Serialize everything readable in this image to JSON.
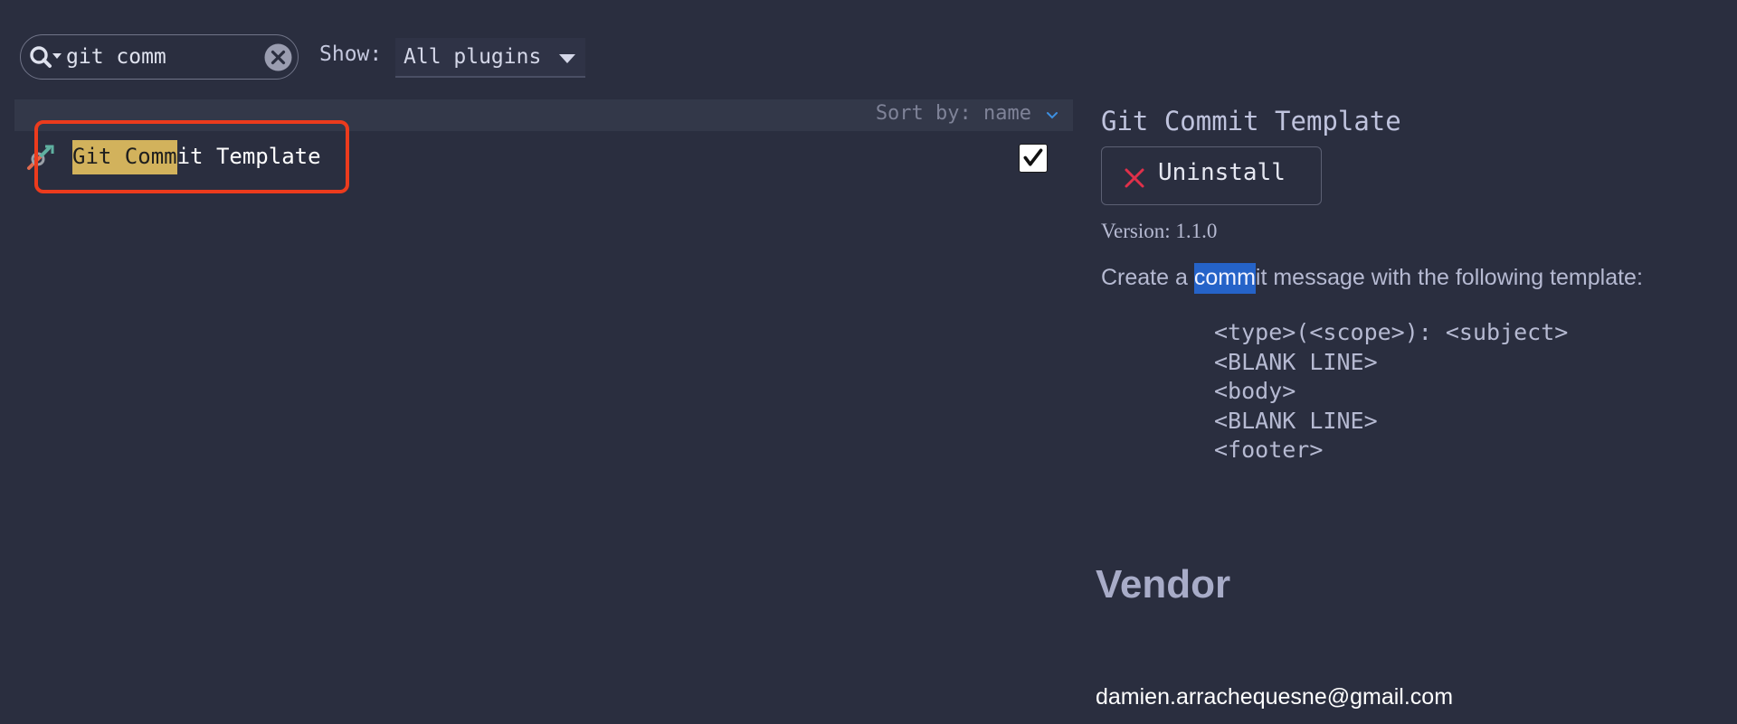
{
  "toolbar": {
    "search": {
      "value": "git comm",
      "icon": "search-icon",
      "clear_icon": "clear-icon"
    },
    "show_label": "Show:",
    "show_value": "All plugins",
    "show_icon": "chevron-down-icon"
  },
  "list": {
    "sort_label": "Sort by: name",
    "sort_icon": "chevron-down-icon",
    "items": [
      {
        "icon": "plugin-icon",
        "name_match": "Git Comm",
        "name_rest": "it Template",
        "enabled": true,
        "check_mark": "✓"
      }
    ]
  },
  "details": {
    "title": "Git Commit Template",
    "uninstall": {
      "icon": "close-icon",
      "label": "Uninstall"
    },
    "version": "Version: 1.1.0",
    "description": {
      "before": "Create a ",
      "match": "comm",
      "after": "it message with the following template:"
    },
    "template_lines": [
      "<type>(<scope>): <subject>",
      "<BLANK LINE>",
      "<body>",
      "<BLANK LINE>",
      "<footer>"
    ],
    "vendor_heading": "Vendor",
    "vendor_email": "damien.arrachequesne@gmail.com"
  },
  "colors": {
    "background": "#2a2e3f",
    "search_highlight": "#d2b25c",
    "text_highlight": "#2563c8",
    "selection_frame": "#ec3b1d",
    "uninstall_icon": "#e0304a",
    "sort_chevron": "#3d8fe0"
  }
}
